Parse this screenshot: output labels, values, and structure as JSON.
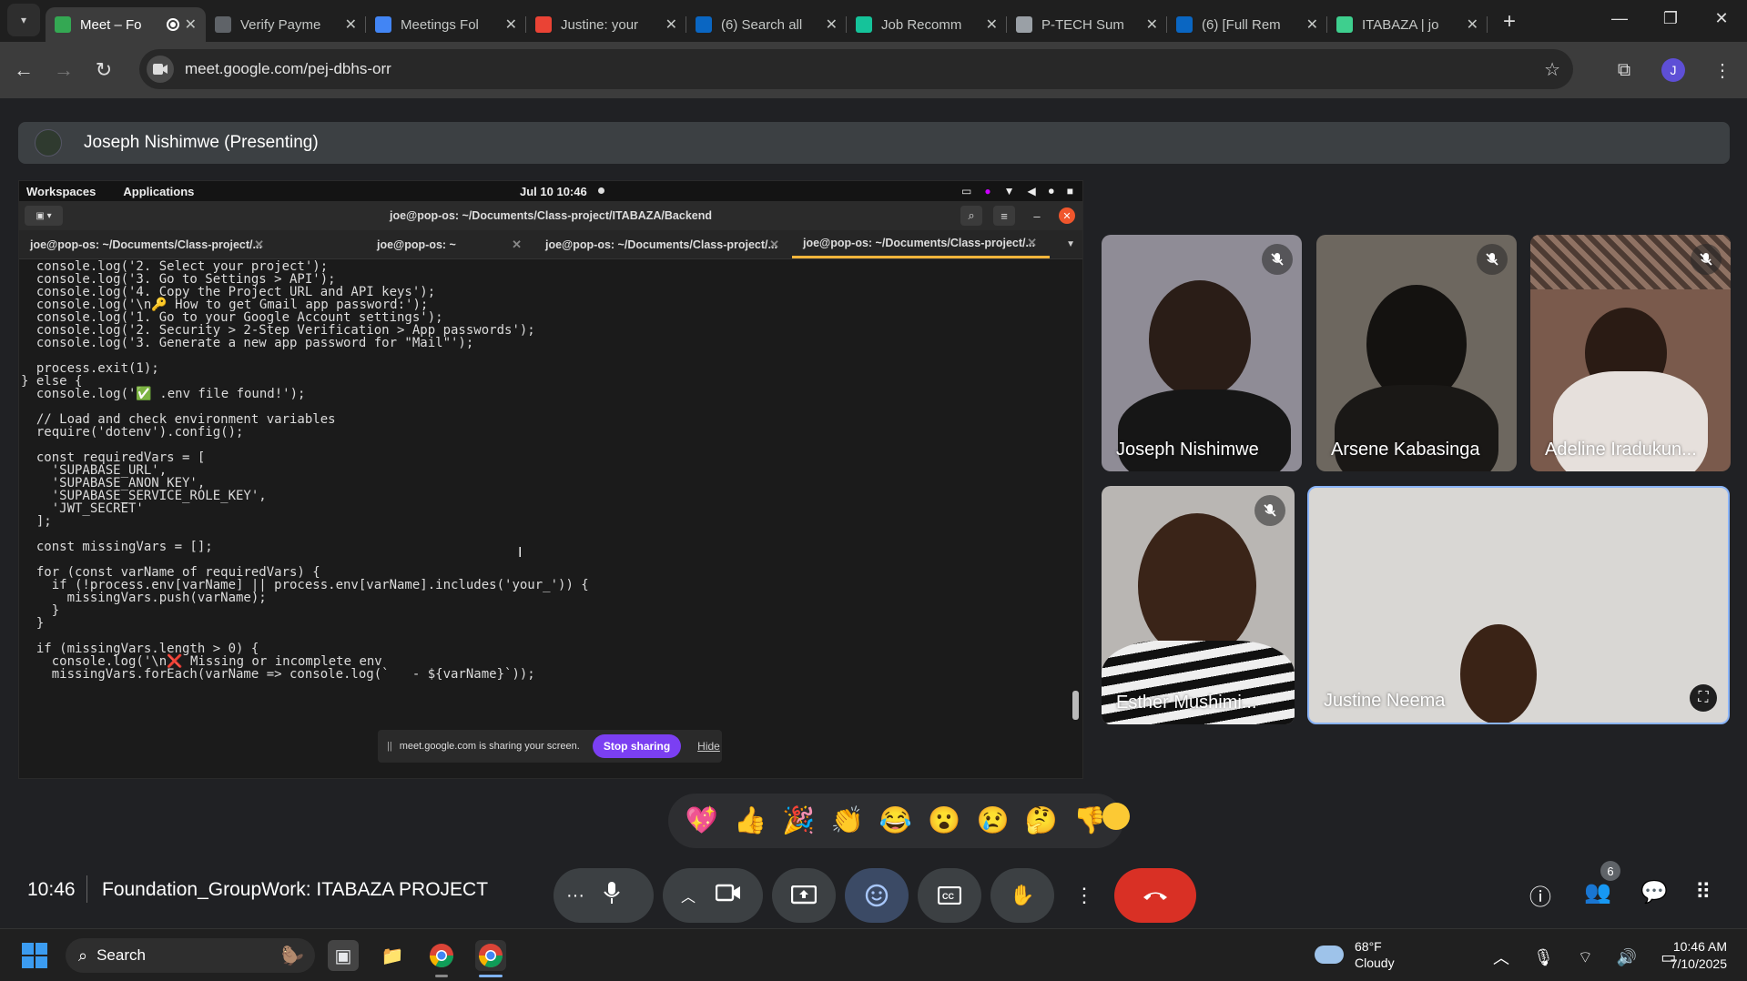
{
  "browser": {
    "tabs": [
      {
        "title": "Meet – Fo",
        "favicon": "google-meet-icon",
        "color": "#34a853",
        "active": true,
        "recording": true
      },
      {
        "title": "Verify Payme",
        "favicon": "globe-icon",
        "color": "#5f6368"
      },
      {
        "title": "Meetings Fol",
        "favicon": "docs-icon",
        "color": "#4285f4"
      },
      {
        "title": "Justine: your",
        "favicon": "gmail-icon",
        "color": "#ea4335"
      },
      {
        "title": "(6) Search all",
        "favicon": "linkedin-icon",
        "color": "#0a66c2"
      },
      {
        "title": "Job Recomm",
        "favicon": "grammarly-icon",
        "color": "#15c39a"
      },
      {
        "title": "P-TECH Sum",
        "favicon": "network-icon",
        "color": "#9aa0a6"
      },
      {
        "title": "(6) [Full Rem",
        "favicon": "linkedin-icon",
        "color": "#0a66c2"
      },
      {
        "title": "ITABAZA | jo",
        "favicon": "bolt-icon",
        "color": "#3ecf8e"
      }
    ],
    "url": "meet.google.com/pej-dbhs-orr",
    "profile_initial": "J"
  },
  "meet": {
    "presenter_label": "Joseph Nishimwe (Presenting)",
    "meeting_time": "10:46",
    "meeting_name": "Foundation_GroupWork: ITABAZA PROJECT",
    "participant_count": "6",
    "reactions": [
      "💖",
      "👍",
      "🎉",
      "👏",
      "😂",
      "😮",
      "😢",
      "🤔",
      "👎"
    ],
    "participants": [
      {
        "name": "Joseph Nishimwe",
        "muted": true
      },
      {
        "name": "Arsene Kabasinga",
        "muted": true
      },
      {
        "name": "Adeline Iradukun...",
        "muted": true
      },
      {
        "name": "Esther Mushimi...",
        "muted": true
      },
      {
        "name": "Justine Neema",
        "muted": false
      }
    ]
  },
  "shared_screen": {
    "topbar": {
      "workspaces": "Workspaces",
      "applications": "Applications",
      "datetime": "Jul 10  10:46"
    },
    "window_title": "joe@pop-os: ~/Documents/Class-project/ITABAZA/Backend",
    "term_tabs": [
      "joe@pop-os: ~/Documents/Class-project/...",
      "joe@pop-os: ~",
      "joe@pop-os: ~/Documents/Class-project/...",
      "joe@pop-os: ~/Documents/Class-project/..."
    ],
    "code_lines": [
      "  console.log('2. Select your project');",
      "  console.log('3. Go to Settings > API');",
      "  console.log('4. Copy the Project URL and API keys');",
      "  console.log('\\n🔑 How to get Gmail app password:');",
      "  console.log('1. Go to your Google Account settings');",
      "  console.log('2. Security > 2-Step Verification > App passwords');",
      "  console.log('3. Generate a new app password for \"Mail\"');",
      "",
      "  process.exit(1);",
      "} else {",
      "  console.log('✅ .env file found!');",
      "",
      "  // Load and check environment variables",
      "  require('dotenv').config();",
      "",
      "  const requiredVars = [",
      "    'SUPABASE_URL',",
      "    'SUPABASE_ANON_KEY',",
      "    'SUPABASE_SERVICE_ROLE_KEY',",
      "    'JWT_SECRET'",
      "  ];",
      "",
      "  const missingVars = [];",
      "",
      "  for (const varName of requiredVars) {",
      "    if (!process.env[varName] || process.env[varName].includes('your_')) {",
      "      missingVars.push(varName);",
      "    }",
      "  }",
      "",
      "  if (missingVars.length > 0) {",
      "    console.log('\\n❌ Missing or incomplete env",
      "    missingVars.forEach(varName => console.log(`   - ${varName}`));"
    ],
    "sharing_notice": {
      "text": "meet.google.com is sharing your screen.",
      "stop": "Stop sharing",
      "hide": "Hide"
    }
  },
  "taskbar": {
    "search_placeholder": "Search",
    "weather_temp": "68°F",
    "weather_desc": "Cloudy",
    "time": "10:46 AM",
    "date": "7/10/2025"
  }
}
